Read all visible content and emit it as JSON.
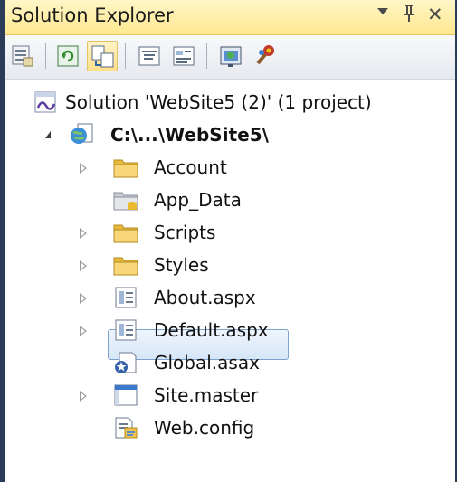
{
  "window": {
    "title": "Solution Explorer",
    "pin_glyph": "Ԅ",
    "close_glyph": "✕"
  },
  "toolbar": {
    "buttons": [
      {
        "name": "properties",
        "icon": "properties-icon"
      },
      {
        "name": "refresh",
        "icon": "refresh-icon"
      },
      {
        "name": "nest-related-files",
        "icon": "nest-related-files-icon"
      },
      {
        "name": "view-code",
        "icon": "view-code-icon"
      },
      {
        "name": "view-designer",
        "icon": "view-designer-icon"
      },
      {
        "name": "copy-website",
        "icon": "copy-website-icon"
      },
      {
        "name": "asp-net-configuration",
        "icon": "asp-net-configuration-icon"
      }
    ]
  },
  "tree": {
    "solution": "Solution 'WebSite5 (2)' (1 project)",
    "project": "C:\\...\\WebSite5\\",
    "items": [
      {
        "label": "Account",
        "icon": "folder-icon",
        "expandable": true
      },
      {
        "label": "App_Data",
        "icon": "data-folder-icon",
        "expandable": false
      },
      {
        "label": "Scripts",
        "icon": "folder-icon",
        "expandable": true
      },
      {
        "label": "Styles",
        "icon": "folder-icon",
        "expandable": true
      },
      {
        "label": "About.aspx",
        "icon": "web-form-icon",
        "expandable": true
      },
      {
        "label": "Default.aspx",
        "icon": "web-form-icon",
        "expandable": true,
        "selected": true
      },
      {
        "label": "Global.asax",
        "icon": "global-asax-icon",
        "expandable": false
      },
      {
        "label": "Site.master",
        "icon": "master-page-icon",
        "expandable": true
      },
      {
        "label": "Web.config",
        "icon": "config-file-icon",
        "expandable": false
      }
    ]
  },
  "colors": {
    "title_bar": "#ffe88f",
    "frame": "#2b3c59",
    "selection": "#d6e6f8",
    "folder": "#f2c94c"
  }
}
